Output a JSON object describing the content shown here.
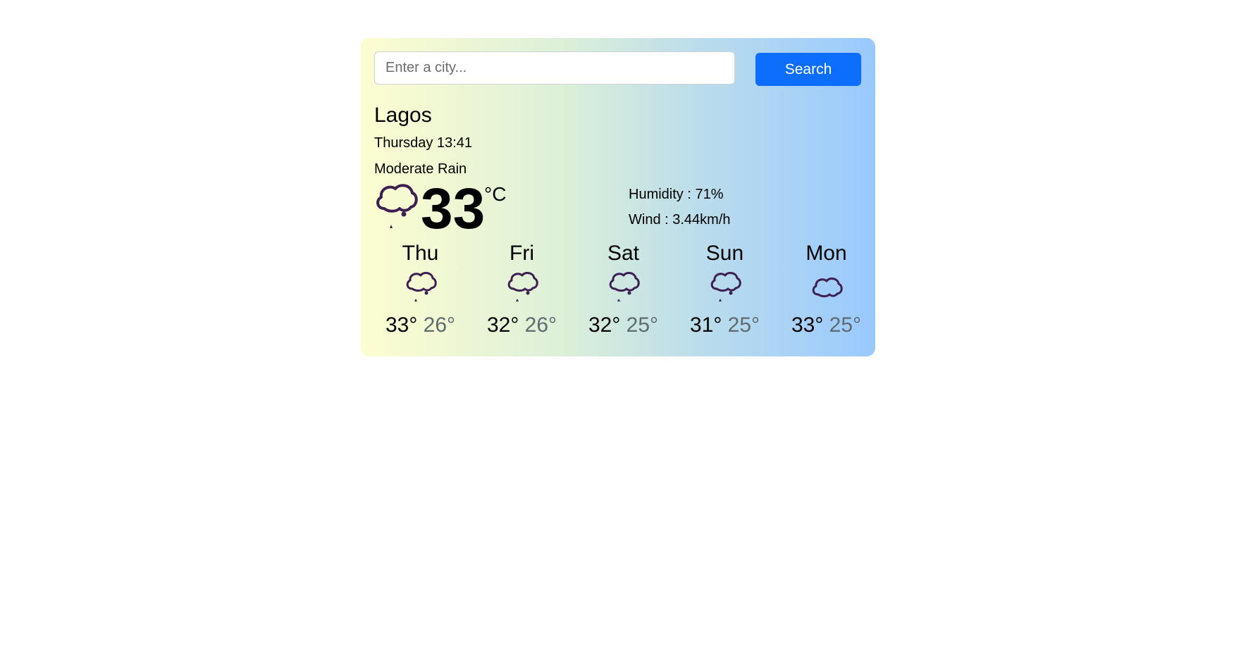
{
  "search": {
    "placeholder": "Enter a city...",
    "value": "",
    "button_label": "Search"
  },
  "current": {
    "city": "Lagos",
    "datetime": "Thursday 13:41",
    "condition": "Moderate Rain",
    "icon": "rain-cloud-icon",
    "temperature": "33",
    "unit": "°C",
    "humidity": "Humidity : 71%",
    "wind": "Wind : 3.44km/h"
  },
  "forecast": [
    {
      "day": "Thu",
      "high": "33°",
      "low": "26°",
      "icon": "rain-cloud-icon"
    },
    {
      "day": "Fri",
      "high": "32°",
      "low": "26°",
      "icon": "rain-cloud-icon"
    },
    {
      "day": "Sat",
      "high": "32°",
      "low": "25°",
      "icon": "rain-cloud-icon"
    },
    {
      "day": "Sun",
      "high": "31°",
      "low": "25°",
      "icon": "rain-cloud-icon"
    },
    {
      "day": "Mon",
      "high": "33°",
      "low": "25°",
      "icon": "cloud-icon"
    }
  ],
  "colors": {
    "button": "#0d6efd",
    "icon_stroke": "#3d1f52",
    "gradient_start": "#fdfdd0",
    "gradient_end": "#9ac9ff"
  }
}
